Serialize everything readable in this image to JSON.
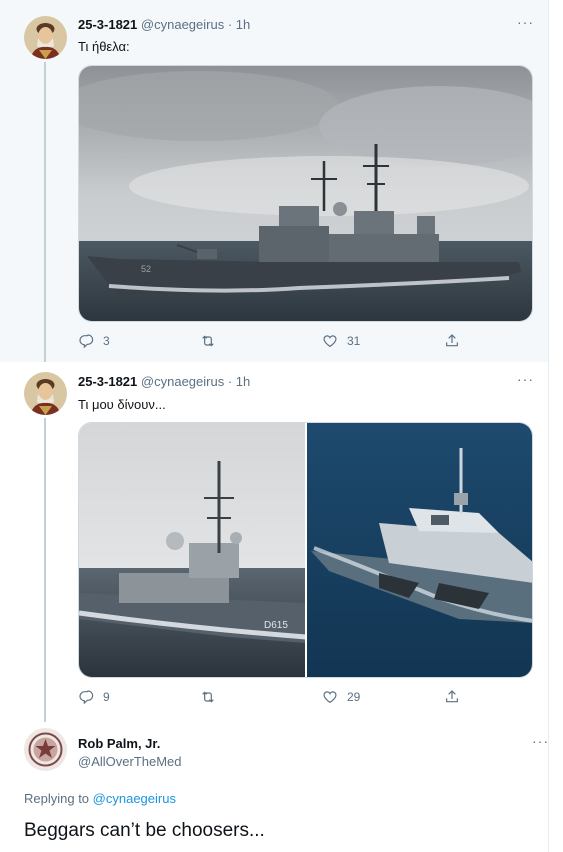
{
  "tweets": [
    {
      "name": "25-3-1821",
      "handle": "@cynaegeirus",
      "dot": "·",
      "time": "1h",
      "text": "Τι ήθελα:",
      "more": "···",
      "image_alt": "Ticonderoga-class cruiser at sea",
      "replies": "3",
      "retweets": "",
      "likes": "31"
    },
    {
      "name": "25-3-1821",
      "handle": "@cynaegeirus",
      "dot": "·",
      "time": "1h",
      "text": "Τι μου δίνουν...",
      "more": "···",
      "image_alt_left": "Frigate with hull number D615",
      "image_alt_right": "Littoral combat ship at sea",
      "replies": "9",
      "retweets": "",
      "likes": "29"
    }
  ],
  "reply": {
    "name": "Rob Palm, Jr.",
    "handle": "@AllOverTheMed",
    "more": "···",
    "replying_prefix": "Replying to",
    "replying_to": "@cynaegeirus",
    "text": "Beggars can’t be choosers..."
  },
  "hull_numbers": {
    "cruiser": "52",
    "frigate": "D615"
  },
  "colors": {
    "accent": "#1b95e0",
    "muted": "#5b7083",
    "hover": "#f5f8fa",
    "thread": "#c4cfd6"
  }
}
